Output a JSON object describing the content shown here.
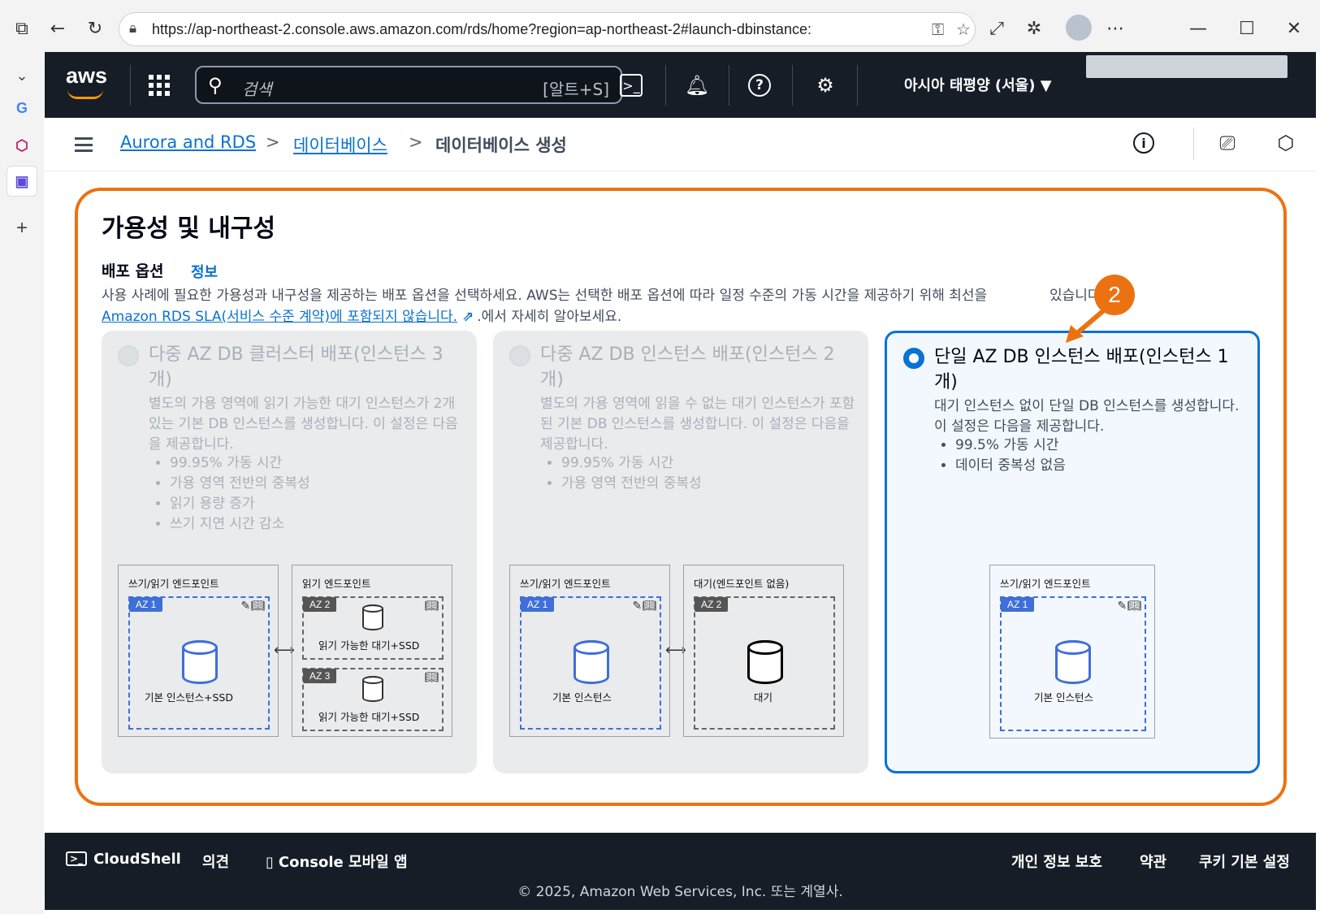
{
  "browser": {
    "url": "https://ap-northeast-2.console.aws.amazon.com/rds/home?region=ap-northeast-2#launch-dbinstance:"
  },
  "aws_header": {
    "logo": "aws",
    "search_placeholder": "검색",
    "search_shortcut": "[알트+S]",
    "region": "아시아 태평양 (서울) ▼"
  },
  "breadcrumb": {
    "items": [
      "Aurora and RDS",
      "데이터베이스",
      "데이터베이스 생성"
    ],
    "separator": ">"
  },
  "section": {
    "title": "가용성 및 내구성",
    "deploy_label": "배포 옵션",
    "info_link": "정보",
    "description_line1": "사용 사례에 필요한 가용성과 내구성을 제공하는 배포 옵션을 선택하세요. AWS는 선택한 배포 옵션에 따라 일정 수준의 가동 시간을 제공하기 위해 최선을",
    "description_line1_end": "있습니다.",
    "sla_link": "Amazon RDS SLA(서비스 수준 계약)에 포함되지 않습니다.",
    "description_line2_end": ".에서 자세히 알아보세요."
  },
  "cards": [
    {
      "title": "다중 AZ DB 클러스터 배포(인스턴스 3 개)",
      "description": "별도의 가용 영역에 읽기 가능한 대기 인스턴스가 2개 있는 기본 DB 인스턴스를 생성합니다. 이 설정은 다음을 제공합니다.",
      "bullets": [
        "99.95% 가동 시간",
        "가용 영역 전반의 중복성",
        "읽기 용량 증가",
        "쓰기 지연 시간 감소"
      ],
      "selected": false,
      "disabled": true,
      "diagram": {
        "left_label": "쓰기/읽기 엔드포인트",
        "right_label": "읽기 엔드포인트",
        "az1": "AZ 1",
        "az2": "AZ 2",
        "az3": "AZ 3",
        "primary_caption": "기본 인스턴스+SSD",
        "standby_caption": "읽기 가능한 대기+SSD"
      }
    },
    {
      "title": "다중 AZ DB 인스턴스 배포(인스턴스 2 개)",
      "description": "별도의 가용 영역에 읽을 수 없는 대기 인스턴스가 포함된 기본 DB 인스턴스를 생성합니다. 이 설정은 다음을 제공합니다.",
      "bullets": [
        "99.95% 가동 시간",
        "가용 영역 전반의 중복성"
      ],
      "selected": false,
      "disabled": true,
      "diagram": {
        "left_label": "쓰기/읽기 엔드포인트",
        "right_label": "대기(엔드포인트 없음)",
        "az1": "AZ 1",
        "az2": "AZ 2",
        "primary_caption": "기본 인스턴스",
        "standby_caption": "대기"
      }
    },
    {
      "title": "단일 AZ DB 인스턴스 배포(인스턴스 1 개)",
      "description": "대기 인스턴스 없이 단일 DB 인스턴스를 생성합니다. 이 설정은 다음을 제공합니다.",
      "bullets": [
        "99.5% 가동 시간",
        "데이터 중복성 없음"
      ],
      "selected": true,
      "disabled": false,
      "diagram": {
        "left_label": "쓰기/읽기 엔드포인트",
        "az1": "AZ 1",
        "primary_caption": "기본 인스턴스"
      }
    }
  ],
  "callout": "2",
  "footer": {
    "cloudshell": "CloudShell",
    "feedback": "의견",
    "mobile_app": "Console 모바일 앱",
    "privacy": "개인 정보 보호",
    "terms": "약관",
    "cookies": "쿠키 기본 설정",
    "copyright": "© 2025, Amazon Web Services, Inc. 또는 계열사."
  },
  "colors": {
    "accent": "#0972d3",
    "highlight": "#ec7211",
    "header_bg": "#161d26"
  }
}
